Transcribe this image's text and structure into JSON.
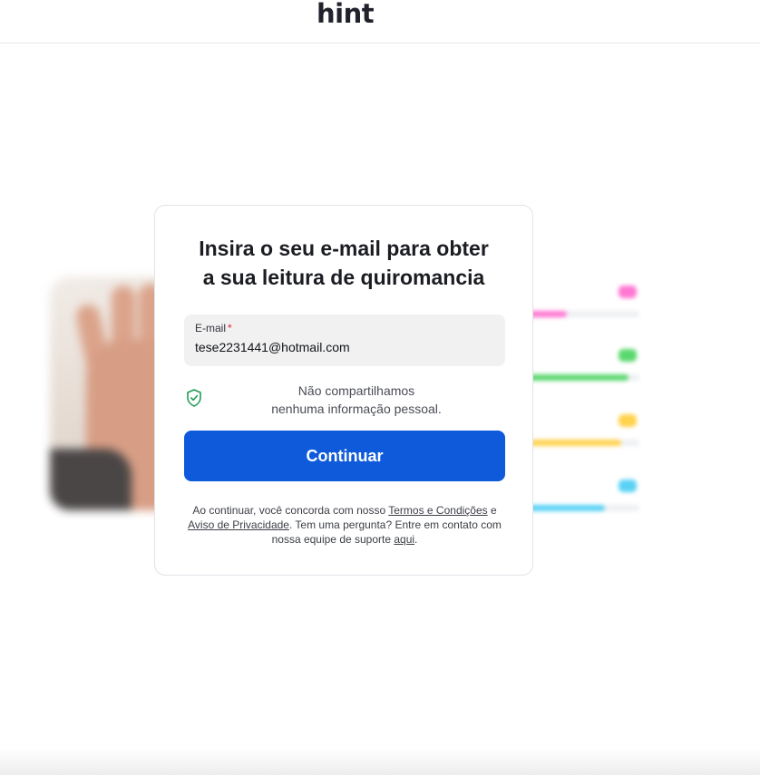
{
  "header": {
    "logo": "hint"
  },
  "card": {
    "title_line1": "Insira o seu e-mail para obter",
    "title_line2": "a sua leitura de quiromancia",
    "email_label": "E-mail",
    "required_mark": "*",
    "email_value": "tese2231441@hotmail.com",
    "privacy_line1": "Não compartilhamos",
    "privacy_line2": "nenhuma informação pessoal.",
    "continue_label": "Continuar",
    "legal": {
      "part1": "Ao continuar, você concorda com nosso ",
      "terms_link": "Termos e Condições",
      "part2": " e ",
      "privacy_link": "Aviso de Privacidade",
      "part3": ". Tem uma pergunta? Entre em contato com nossa equipe de suporte ",
      "here_link": "aqui",
      "part4": "."
    }
  },
  "icons": {
    "shield": "shield-check-icon"
  },
  "background_bars": [
    {
      "color": "#ff78d2",
      "fill": 0.45
    },
    {
      "color": "#5ad86e",
      "fill": 0.92
    },
    {
      "color": "#ffd24d",
      "fill": 0.86
    },
    {
      "color": "#5ad2f5",
      "fill": 0.74
    }
  ],
  "colors": {
    "primary": "#0e5adb",
    "required": "#e3203a",
    "shield": "#1f9d55"
  }
}
